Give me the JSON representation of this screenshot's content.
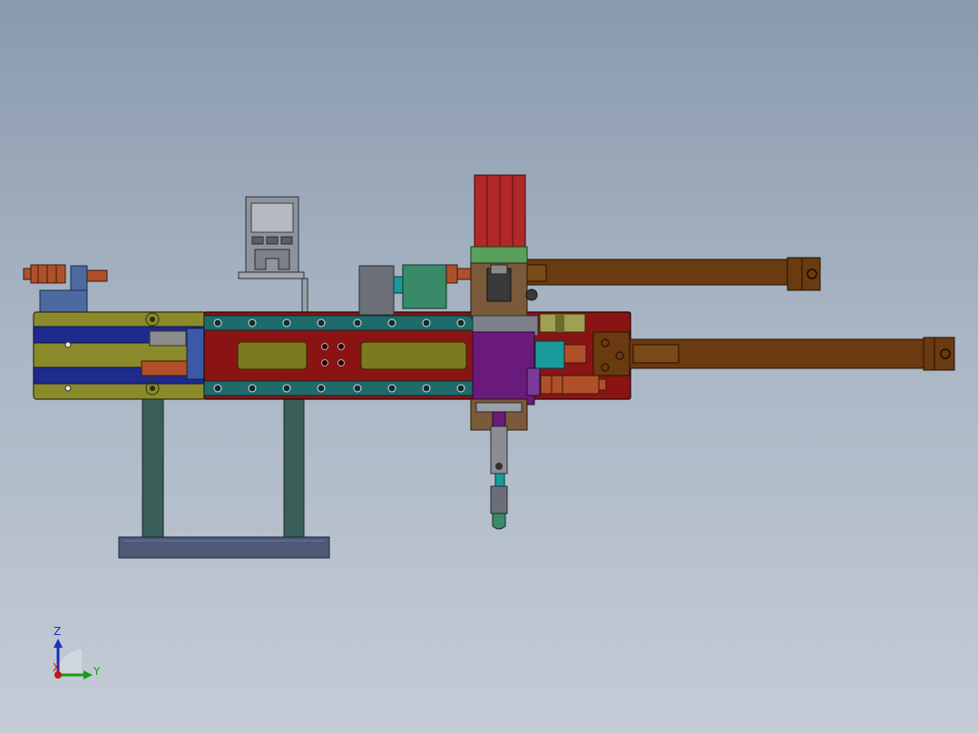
{
  "viewport": {
    "background_top": "#8a99ae",
    "background_bottom": "#c4ccd6"
  },
  "triad": {
    "z_label": "Z",
    "y_label": "Y",
    "x_label": "X",
    "z_color": "#1b2fbf",
    "y_color": "#1a9a1a",
    "x_color": "#c01818"
  },
  "palette": {
    "rail_olive": "#8a8a2a",
    "slot_navy": "#1e2a8c",
    "plate_red": "#8a1414",
    "strip_teal": "#1f6a6a",
    "window_olive": "#7a7a20",
    "rod_brown": "#6a3a10",
    "cylinder_red": "#b02828",
    "block_purple": "#6a1a7a",
    "stand_green": "#3a5e58",
    "foot_slate": "#4c5a78",
    "fitting_copper": "#b0502a",
    "valve_green": "#3a8a6a"
  }
}
